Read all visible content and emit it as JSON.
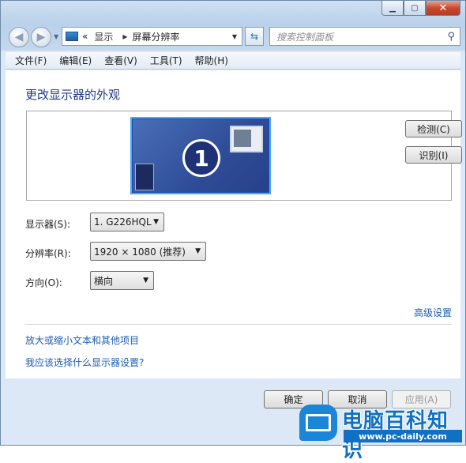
{
  "window": {
    "controls": {
      "minimize": "▁",
      "maximize": "▢",
      "close": "✕"
    }
  },
  "nav": {
    "back_icon": "back-arrow-icon",
    "forward_icon": "forward-arrow-icon",
    "breadcrumb": {
      "prefix": "«",
      "item1": "显示",
      "separator": "▸",
      "item2": "屏幕分辨率"
    },
    "refresh_icon": "refresh-icon",
    "search_placeholder": "搜索控制面板",
    "search_icon": "search-icon"
  },
  "menu": {
    "items": [
      "文件(F)",
      "编辑(E)",
      "查看(V)",
      "工具(T)",
      "帮助(H)"
    ]
  },
  "main": {
    "title": "更改显示器的外观",
    "monitor_number": "1",
    "detect_button": "检测(C)",
    "identify_button": "识别(I)",
    "display_label": "显示器(S):",
    "display_value": "1. G226HQL",
    "resolution_label": "分辨率(R):",
    "resolution_value": "1920 × 1080 (推荐)",
    "orientation_label": "方向(O):",
    "orientation_value": "横向",
    "advanced_link": "高级设置",
    "text_size_link": "放大或缩小文本和其他项目",
    "help_link": "我应该选择什么显示器设置?"
  },
  "footer": {
    "ok_button": "确定",
    "cancel_button": "取消",
    "apply_button": "应用(A)"
  },
  "watermark": {
    "brand": "电脑百科知识",
    "url": "www.pc-daily.com"
  },
  "colors": {
    "link": "#1a5cb5",
    "title": "#1e3a8a",
    "watermark_blue": "#1170c4"
  }
}
